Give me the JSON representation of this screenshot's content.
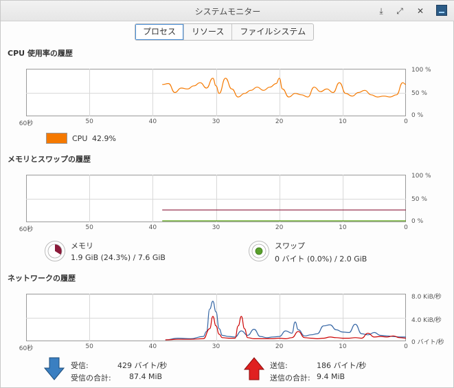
{
  "window": {
    "title": "システムモニター"
  },
  "titlebar": {
    "icons": [
      "download-icon",
      "maximize-icon",
      "close-icon",
      "app-icon"
    ],
    "download_glyph": "⤓",
    "maximize_glyph": "⤢",
    "close_glyph": "✕"
  },
  "tabs": [
    {
      "label": "プロセス",
      "active": true
    },
    {
      "label": "リソース",
      "active": false
    },
    {
      "label": "ファイルシステム",
      "active": false
    }
  ],
  "cpu": {
    "title": "CPU 使用率の履歴",
    "legend_label": "CPU",
    "legend_value": "42.9%",
    "color": "#f57900"
  },
  "memory": {
    "title": "メモリとスワップの履歴",
    "mem_label": "メモリ",
    "mem_value": "1.9 GiB (24.3%) / 7.6 GiB",
    "swap_label": "スワップ",
    "swap_value": "0 バイト (0.0%) / 2.0 GiB",
    "mem_color": "#8b1a3a",
    "swap_color": "#4e9a06"
  },
  "network": {
    "title": "ネットワークの履歴",
    "recv_label": "受信:",
    "recv_rate": "429 バイト/秒",
    "recv_total_label": "受信の合計:",
    "recv_total": "87.4 MiB",
    "send_label": "送信:",
    "send_rate": "186 バイト/秒",
    "send_total_label": "送信の合計:",
    "send_total": "9.4 MiB",
    "recv_color": "#3465a4",
    "send_color": "#cc0000"
  },
  "axes": {
    "x_ticks": [
      "60秒",
      "50",
      "40",
      "30",
      "20",
      "10",
      "0"
    ],
    "pct_ticks": [
      "100 %",
      "50 %",
      "0 %"
    ],
    "net_ticks": [
      "8.0 KiB/秒",
      "4.0 KiB/秒",
      "0 バイト/秒"
    ]
  },
  "chart_data": [
    {
      "type": "line",
      "title": "CPU 使用率の履歴",
      "xlabel": "",
      "ylabel": "",
      "xlim": [
        60,
        0
      ],
      "ylim": [
        0,
        100
      ],
      "x_ticks": [
        "60秒",
        "50",
        "40",
        "30",
        "20",
        "10",
        "0"
      ],
      "y_ticks": [
        "100 %",
        "50 %",
        "0 %"
      ],
      "series": [
        {
          "name": "CPU",
          "color": "#f57900",
          "x": [
            38.5,
            37.5,
            36.5,
            35.5,
            34.5,
            33.5,
            32.5,
            31.5,
            30.5,
            30,
            29.5,
            28.5,
            27.5,
            26.5,
            25.5,
            24.5,
            23.5,
            22.5,
            21.5,
            20.5,
            20,
            19.5,
            18.5,
            17.5,
            16.5,
            15.5,
            14.5,
            13.5,
            12.5,
            11.5,
            10.5,
            9.5,
            8.5,
            7.5,
            6.5,
            5.5,
            4.5,
            3.5,
            2.5,
            1.5,
            0.5,
            0
          ],
          "y": [
            68,
            70,
            50,
            60,
            58,
            65,
            72,
            60,
            82,
            65,
            48,
            82,
            58,
            40,
            48,
            55,
            62,
            55,
            62,
            70,
            82,
            58,
            40,
            48,
            45,
            40,
            62,
            52,
            58,
            50,
            72,
            48,
            42,
            50,
            55,
            45,
            40,
            42,
            40,
            45,
            72,
            68
          ]
        }
      ],
      "grid": true
    },
    {
      "type": "line",
      "title": "メモリとスワップの履歴",
      "xlim": [
        60,
        0
      ],
      "ylim": [
        0,
        100
      ],
      "x_ticks": [
        "60秒",
        "50",
        "40",
        "30",
        "20",
        "10",
        "0"
      ],
      "y_ticks": [
        "100 %",
        "50 %",
        "0 %"
      ],
      "series": [
        {
          "name": "メモリ",
          "color": "#8b1a3a",
          "x": [
            38.5,
            0
          ],
          "y": [
            24.3,
            24.3
          ]
        },
        {
          "name": "スワップ",
          "color": "#4e9a06",
          "x": [
            38.5,
            0
          ],
          "y": [
            0.0,
            0.0
          ]
        }
      ],
      "grid": true
    },
    {
      "type": "line",
      "title": "ネットワークの履歴",
      "xlim": [
        60,
        0
      ],
      "ylim": [
        0,
        8.0
      ],
      "x_ticks": [
        "60秒",
        "50",
        "40",
        "30",
        "20",
        "10",
        "0"
      ],
      "y_ticks": [
        "8.0 KiB/秒",
        "4.0 KiB/秒",
        "0 バイト/秒"
      ],
      "series": [
        {
          "name": "受信",
          "color": "#3465a4",
          "x": [
            38,
            36,
            34,
            32,
            31.5,
            31,
            30.5,
            30,
            29.5,
            29,
            28,
            27,
            26,
            25,
            24,
            23,
            22,
            21,
            20,
            19,
            18,
            17.5,
            17,
            16,
            15,
            14,
            13,
            12,
            11,
            10,
            9,
            8,
            7,
            6,
            5,
            4,
            3,
            2,
            1,
            0
          ],
          "y": [
            0,
            0.3,
            0.2,
            0.6,
            1.5,
            5.5,
            6.9,
            5,
            2,
            0.8,
            0.6,
            0.5,
            1.6,
            0.8,
            1.9,
            0.6,
            0.4,
            0.5,
            0.6,
            1.6,
            1.2,
            3.2,
            1.8,
            0.7,
            0.9,
            1.1,
            2.5,
            2.7,
            1.8,
            1.4,
            1.3,
            2.8,
            1.1,
            0.9,
            1.3,
            0.8,
            0.7,
            0.6,
            0.5,
            0.5
          ]
        },
        {
          "name": "送信",
          "color": "#cc0000",
          "x": [
            38,
            36,
            34,
            32,
            31,
            30.5,
            30,
            29.5,
            29,
            28,
            27,
            26.5,
            26,
            25.5,
            25,
            24,
            23,
            22,
            21,
            20,
            19,
            18,
            17,
            16,
            15,
            14,
            13,
            12,
            11,
            10,
            9,
            8,
            7,
            6,
            5,
            4,
            3,
            2,
            1,
            0
          ],
          "y": [
            0,
            0.1,
            0.1,
            0.2,
            2,
            4.2,
            2.5,
            1,
            0.4,
            0.3,
            0.3,
            2.5,
            4.2,
            2,
            0.4,
            0.2,
            0.2,
            0.2,
            0.2,
            0.3,
            0.2,
            0.4,
            1.5,
            0.4,
            0.3,
            0.2,
            0.3,
            0.5,
            0.4,
            0.3,
            0.3,
            0.4,
            0.3,
            1.2,
            0.5,
            0.6,
            0.5,
            0.7,
            0.4,
            0.3
          ]
        }
      ],
      "grid": true
    }
  ]
}
